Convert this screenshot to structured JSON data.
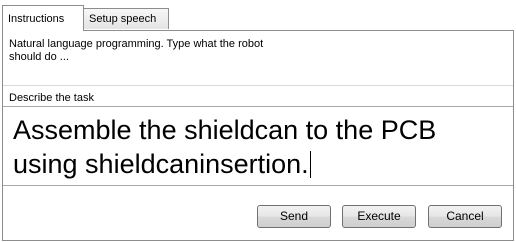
{
  "tabs": [
    {
      "label": "Instructions",
      "active": true
    },
    {
      "label": "Setup speech",
      "active": false
    }
  ],
  "instructions": {
    "text": "Natural language programming. Type what the robot should do ..."
  },
  "task": {
    "label": "Describe the task",
    "value": "Assemble the shieldcan to the PCB using shieldcaninsertion."
  },
  "buttons": {
    "send": "Send",
    "execute": "Execute",
    "cancel": "Cancel"
  }
}
